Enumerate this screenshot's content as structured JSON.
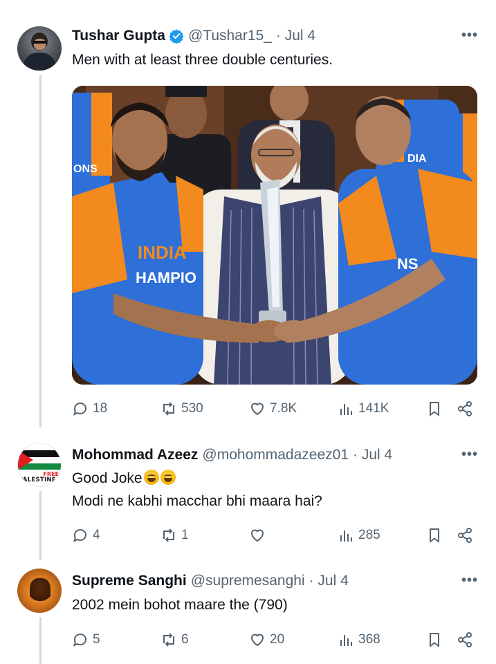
{
  "tweets": [
    {
      "name": "Tushar Gupta",
      "handle": "@Tushar15_",
      "date": "· Jul 4",
      "verified": true,
      "text": "Men with at least three double centuries.",
      "image": {
        "jersey_text_left": "INDIA",
        "jersey_text_left2": "HAMPIO",
        "jersey_text_right": "NS",
        "jersey_text_back": "ONS",
        "jersey_text_back_right": "DIA"
      },
      "stats": {
        "replies": "18",
        "retweets": "530",
        "likes": "7.8K",
        "views": "141K"
      }
    },
    {
      "name": "Mohommad Azeez",
      "handle": "@mohommadazeez01",
      "date": "· Jul 4",
      "avatar_text_top": "FREE",
      "avatar_text_bottom": "PALESTINE",
      "text_line1": "Good Joke",
      "text_line2": "Modi ne kabhi macchar bhi maara hai?",
      "stats": {
        "replies": "4",
        "retweets": "1",
        "likes": "",
        "views": "285"
      }
    },
    {
      "name": "Supreme Sanghi",
      "handle": "@supremesanghi",
      "date": "· Jul 4",
      "text": "2002 mein bohot maare the (790)",
      "stats": {
        "replies": "5",
        "retweets": "6",
        "likes": "20",
        "views": "368"
      }
    }
  ],
  "icons": [
    "reply-icon",
    "retweet-icon",
    "like-icon",
    "views-icon",
    "bookmark-icon",
    "share-icon",
    "more-icon",
    "verified-icon"
  ],
  "colors": {
    "text": "#0f1419",
    "secondary": "#536471",
    "verified": "#1d9bf0",
    "thread_line": "#cfd9de",
    "jersey_blue": "#2e6fd8",
    "jersey_orange": "#f28a1e"
  }
}
